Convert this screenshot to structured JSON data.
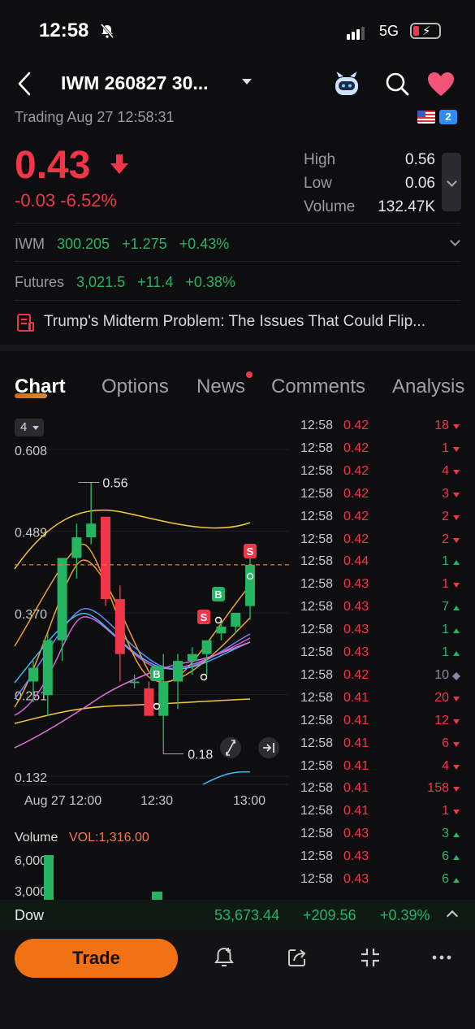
{
  "status_bar": {
    "time": "12:58",
    "network": "5G"
  },
  "header": {
    "title": "IWM 260827 30...",
    "trading": "Trading Aug 27 12:58:31",
    "badge": "2"
  },
  "price": {
    "last": "0.43",
    "change": "-0.03",
    "change_pct": "-6.52%"
  },
  "stats": {
    "high_label": "High",
    "high": "0.56",
    "low_label": "Low",
    "low": "0.06",
    "volume_label": "Volume",
    "volume": "132.47K"
  },
  "underlying": {
    "symbol": "IWM",
    "price": "300.205",
    "change": "+1.275",
    "change_pct": "+0.43%"
  },
  "futures": {
    "label": "Futures",
    "price": "3,021.5",
    "change": "+11.4",
    "change_pct": "+0.38%"
  },
  "news_headline": "Trump's Midterm Problem: The Issues That Could Flip...",
  "tabs": [
    "Chart",
    "Options",
    "News",
    "Comments",
    "Analysis"
  ],
  "chart": {
    "period": "4",
    "y_ticks": [
      "0.608",
      "0.489",
      "0.370",
      "0.251",
      "0.132"
    ],
    "x_ticks": [
      "Aug 27 12:00",
      "12:30",
      "13:00"
    ],
    "high_marker": "0.56",
    "low_marker": "0.18",
    "signal_buy": "B",
    "signal_sell": "S"
  },
  "chart_data": {
    "type": "candlestick",
    "ylim": [
      0.132,
      0.608
    ],
    "candles": [
      {
        "o": 0.27,
        "h": 0.3,
        "l": 0.24,
        "c": 0.29
      },
      {
        "o": 0.25,
        "h": 0.34,
        "l": 0.22,
        "c": 0.33
      },
      {
        "o": 0.33,
        "h": 0.45,
        "l": 0.3,
        "c": 0.45
      },
      {
        "o": 0.45,
        "h": 0.5,
        "l": 0.42,
        "c": 0.48
      },
      {
        "o": 0.48,
        "h": 0.56,
        "l": 0.47,
        "c": 0.5
      },
      {
        "o": 0.51,
        "h": 0.51,
        "l": 0.38,
        "c": 0.39
      },
      {
        "o": 0.39,
        "h": 0.41,
        "l": 0.27,
        "c": 0.31
      },
      {
        "o": 0.27,
        "h": 0.28,
        "l": 0.26,
        "c": 0.27
      },
      {
        "o": 0.26,
        "h": 0.27,
        "l": 0.23,
        "c": 0.22
      },
      {
        "o": 0.22,
        "h": 0.31,
        "l": 0.18,
        "c": 0.27
      },
      {
        "o": 0.27,
        "h": 0.31,
        "l": 0.23,
        "c": 0.3
      },
      {
        "o": 0.3,
        "h": 0.32,
        "l": 0.28,
        "c": 0.31
      },
      {
        "o": 0.31,
        "h": 0.32,
        "l": 0.28,
        "c": 0.33
      },
      {
        "o": 0.34,
        "h": 0.36,
        "l": 0.33,
        "c": 0.35
      },
      {
        "o": 0.35,
        "h": 0.36,
        "l": 0.34,
        "c": 0.37
      },
      {
        "o": 0.38,
        "h": 0.46,
        "l": 0.36,
        "c": 0.44
      }
    ],
    "current_price": 0.44,
    "ma_colors": [
      "#f5c842",
      "#f0a030",
      "#e060e0",
      "#6a8af5",
      "#3fb8f5"
    ]
  },
  "ticks": [
    {
      "t": "12:58",
      "p": "0.42",
      "v": "18",
      "dir": "down"
    },
    {
      "t": "12:58",
      "p": "0.42",
      "v": "1",
      "dir": "down"
    },
    {
      "t": "12:58",
      "p": "0.42",
      "v": "4",
      "dir": "down"
    },
    {
      "t": "12:58",
      "p": "0.42",
      "v": "3",
      "dir": "down"
    },
    {
      "t": "12:58",
      "p": "0.42",
      "v": "2",
      "dir": "down"
    },
    {
      "t": "12:58",
      "p": "0.42",
      "v": "2",
      "dir": "down"
    },
    {
      "t": "12:58",
      "p": "0.44",
      "v": "1",
      "dir": "up"
    },
    {
      "t": "12:58",
      "p": "0.43",
      "v": "1",
      "dir": "down"
    },
    {
      "t": "12:58",
      "p": "0.43",
      "v": "7",
      "dir": "up"
    },
    {
      "t": "12:58",
      "p": "0.43",
      "v": "1",
      "dir": "up"
    },
    {
      "t": "12:58",
      "p": "0.43",
      "v": "1",
      "dir": "up"
    },
    {
      "t": "12:58",
      "p": "0.42",
      "v": "10",
      "dir": "neutral"
    },
    {
      "t": "12:58",
      "p": "0.41",
      "v": "20",
      "dir": "down"
    },
    {
      "t": "12:58",
      "p": "0.41",
      "v": "12",
      "dir": "down"
    },
    {
      "t": "12:58",
      "p": "0.41",
      "v": "6",
      "dir": "down"
    },
    {
      "t": "12:58",
      "p": "0.41",
      "v": "4",
      "dir": "down"
    },
    {
      "t": "12:58",
      "p": "0.41",
      "v": "158",
      "dir": "down"
    },
    {
      "t": "12:58",
      "p": "0.41",
      "v": "1",
      "dir": "down"
    },
    {
      "t": "12:58",
      "p": "0.43",
      "v": "3",
      "dir": "up"
    },
    {
      "t": "12:58",
      "p": "0.43",
      "v": "6",
      "dir": "up"
    },
    {
      "t": "12:58",
      "p": "0.43",
      "v": "6",
      "dir": "up"
    }
  ],
  "volume": {
    "label": "Volume",
    "value": "VOL:1,316.00",
    "axis": [
      "6,000",
      "3,000"
    ]
  },
  "dow": {
    "label": "Dow",
    "price": "53,673.44",
    "change": "+209.56",
    "change_pct": "+0.39%"
  },
  "bottom": {
    "trade": "Trade"
  }
}
